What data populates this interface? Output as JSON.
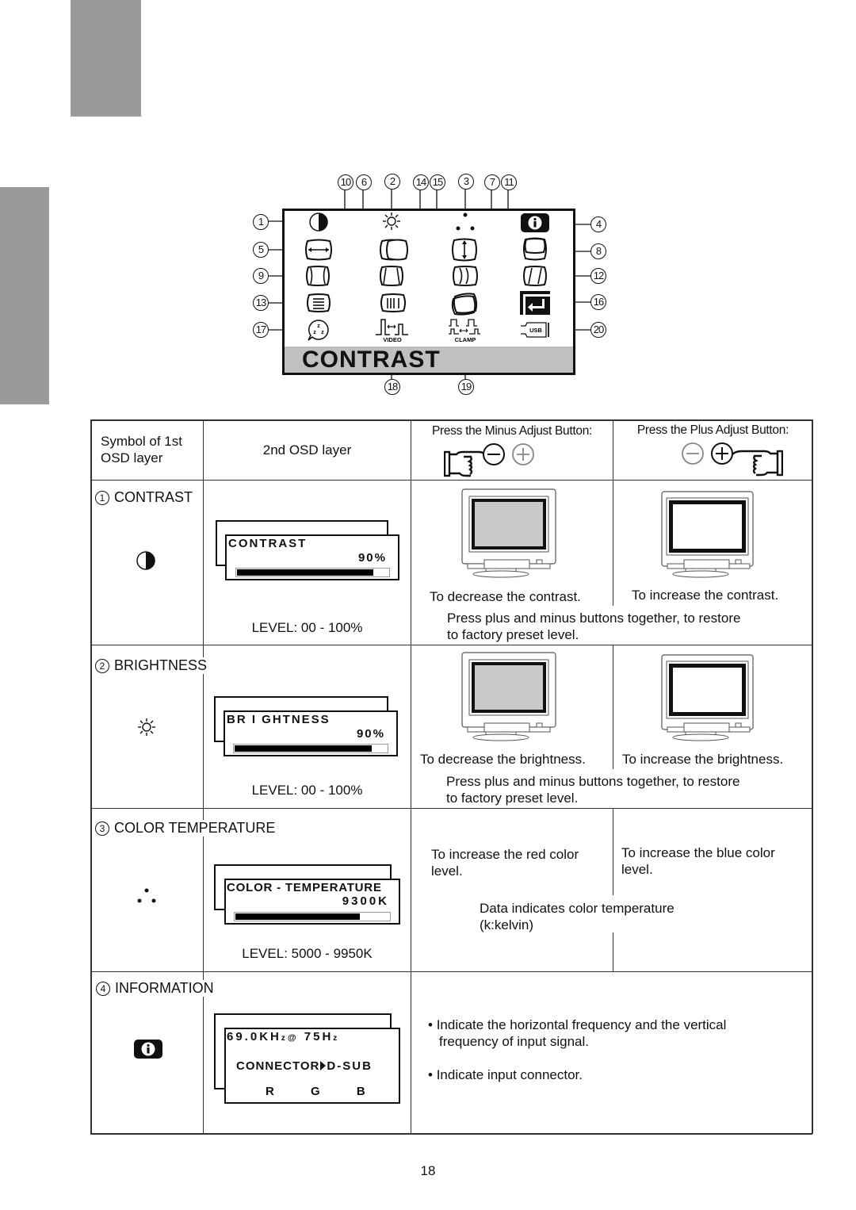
{
  "page": {
    "page_number": "18"
  },
  "osd_diagram": {
    "status_text": "CONTRAST",
    "callouts_top": [
      "10",
      "6",
      "2",
      "14",
      "15",
      "3",
      "7",
      "11"
    ],
    "callouts_left": [
      "1",
      "5",
      "9",
      "13",
      "17"
    ],
    "callouts_right": [
      "4",
      "8",
      "12",
      "16",
      "20"
    ],
    "callouts_bottom": [
      "18",
      "19"
    ],
    "icons": [
      {
        "id": 1,
        "name": "contrast-icon"
      },
      {
        "id": 2,
        "name": "brightness-icon"
      },
      {
        "id": 3,
        "name": "color-temperature-icon"
      },
      {
        "id": 4,
        "name": "information-icon"
      },
      {
        "id": 5,
        "name": "horizontal-size-icon"
      },
      {
        "id": 6,
        "name": "horizontal-position-icon"
      },
      {
        "id": 7,
        "name": "vertical-size-icon"
      },
      {
        "id": 8,
        "name": "vertical-position-icon"
      },
      {
        "id": 9,
        "name": "pincushion-icon"
      },
      {
        "id": 10,
        "name": "trapezoid-icon"
      },
      {
        "id": 11,
        "name": "pin-balance-icon"
      },
      {
        "id": 12,
        "name": "parallelogram-icon"
      },
      {
        "id": 13,
        "name": "moire-icon"
      },
      {
        "id": 14,
        "name": "vertical-moire-icon"
      },
      {
        "id": 15,
        "name": "rotation-icon"
      },
      {
        "id": 16,
        "name": "exit-icon"
      },
      {
        "id": 17,
        "name": "power-save-icon"
      },
      {
        "id": 18,
        "name": "video-icon"
      },
      {
        "id": 19,
        "name": "clamp-icon"
      },
      {
        "id": 20,
        "name": "usb-icon"
      }
    ],
    "video_label": "VIDEO",
    "clamp_label": "CLAMP",
    "usb_label": "USB"
  },
  "table": {
    "header": {
      "col1": "Symbol of 1st\nOSD layer",
      "col1_line1": "Symbol of 1st",
      "col1_line2": "OSD layer",
      "col2": "2nd OSD layer",
      "col3": "Press the Minus Adjust Button:",
      "col4": "Press the Plus Adjust Button:"
    },
    "rows": [
      {
        "num": "1",
        "label": "CONTRAST",
        "osd_title": "CONTRAST",
        "osd_value": "90%",
        "osd_progress": 0.9,
        "level": "LEVEL: 00 - 100%",
        "minus_text": "To decrease the contrast.",
        "plus_text": "To increase the contrast.",
        "note_line1": "Press plus and minus buttons together, to restore",
        "note_line2": "to factory preset level."
      },
      {
        "num": "2",
        "label": "BRIGHTNESS",
        "osd_title": "BR I GHTNESS",
        "osd_value": "90%",
        "osd_progress": 0.9,
        "level": "LEVEL: 00 - 100%",
        "minus_text": "To decrease the brightness.",
        "plus_text": "To increase the brightness.",
        "note_line1": "Press plus and minus buttons together, to restore",
        "note_line2": "to factory preset level."
      },
      {
        "num": "3",
        "label": "COLOR TEMPERATURE",
        "osd_title": "COLOR - TEMPERATURE",
        "osd_value": "9300K",
        "osd_progress": 0.81,
        "level": "LEVEL: 5000 - 9950K",
        "minus_line1": "To increase the red color",
        "minus_line2": "level.",
        "plus_line1": "To increase the blue color",
        "plus_line2": "level.",
        "note_line1": "Data indicates color temperature",
        "note_line2": "(k:kelvin)"
      },
      {
        "num": "4",
        "label": "INFORMATION",
        "osd_freq": "69.0KHz@ 75Hz",
        "osd_freq_h": "69.0KH",
        "osd_freq_z1": "z",
        "osd_freq_at": "@",
        "osd_freq_v": "75H",
        "osd_freq_z2": "z",
        "osd_connector_label": "CONNECTOR",
        "osd_connector_value": "D-SUB",
        "osd_rgb": [
          "R",
          "G",
          "B"
        ],
        "bullet1_line1": "Indicate the horizontal frequency and the vertical",
        "bullet1_line2": "frequency of input signal.",
        "bullet2": "Indicate input connector."
      }
    ]
  }
}
